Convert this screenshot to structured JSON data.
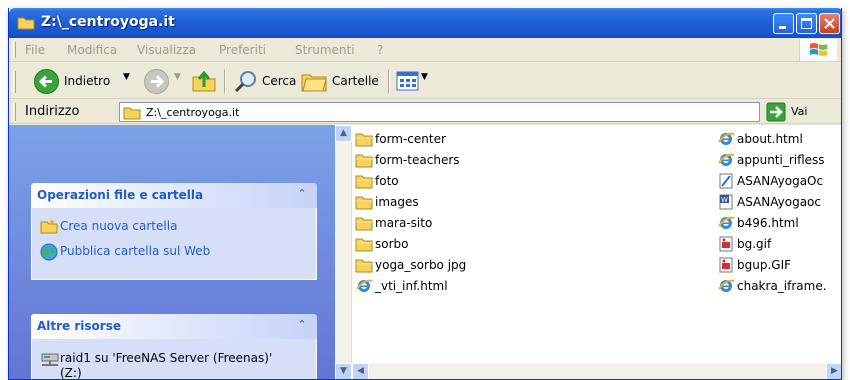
{
  "window": {
    "title": "Z:\\_centroyoga.it"
  },
  "menu": [
    "File",
    "Modifica",
    "Visualizza",
    "Preferiti",
    "Strumenti",
    "?"
  ],
  "toolbar": {
    "back_label": "Indietro",
    "search_label": "Cerca",
    "folders_label": "Cartelle"
  },
  "address": {
    "label": "Indirizzo",
    "value": "Z:\\_centroyoga.it",
    "go_label": "Vai"
  },
  "tasks": {
    "file_ops": {
      "title": "Operazioni file e cartella",
      "items": [
        "Crea nuova cartella",
        "Pubblica cartella sul Web"
      ]
    },
    "other": {
      "title": "Altre risorse",
      "items": [
        "raid1 su 'FreeNAS Server (Freenas)' (Z:)"
      ]
    }
  },
  "files_col1": [
    {
      "name": "form-center",
      "icon": "folder-icon"
    },
    {
      "name": "form-teachers",
      "icon": "folder-icon"
    },
    {
      "name": "foto",
      "icon": "folder-icon"
    },
    {
      "name": "images",
      "icon": "folder-icon"
    },
    {
      "name": "mara-sito",
      "icon": "folder-icon"
    },
    {
      "name": "sorbo",
      "icon": "folder-icon"
    },
    {
      "name": "yoga_sorbo jpg",
      "icon": "folder-icon"
    },
    {
      "name": "_vti_inf.html",
      "icon": "ie-icon"
    }
  ],
  "files_col2": [
    {
      "name": "about.html",
      "icon": "ie-icon"
    },
    {
      "name": "appunti_rifless",
      "icon": "ie-icon"
    },
    {
      "name": "ASANAyogaOc",
      "icon": "document-icon"
    },
    {
      "name": "ASANAyogaoc",
      "icon": "word-icon"
    },
    {
      "name": "b496.html",
      "icon": "ie-icon"
    },
    {
      "name": "bg.gif",
      "icon": "image-icon"
    },
    {
      "name": "bgup.GIF",
      "icon": "image-icon"
    },
    {
      "name": "chakra_iframe.",
      "icon": "ie-icon"
    }
  ],
  "colors": {
    "title_bar": "#1e5ed6",
    "task_pane": "#7ba2e7",
    "link": "#215dc6"
  }
}
